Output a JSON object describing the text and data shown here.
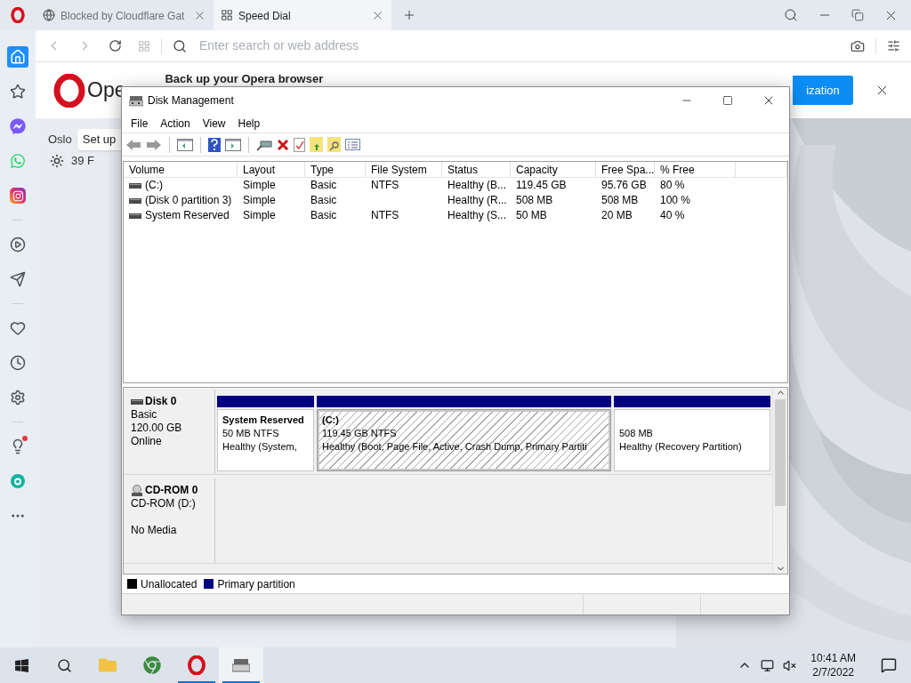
{
  "browser": {
    "tabs": [
      {
        "title": "Blocked by Cloudflare Gat",
        "selected": false
      },
      {
        "title": "Speed Dial",
        "selected": true
      }
    ],
    "address_placeholder": "Enter search or web address",
    "sidebar": [
      {
        "selected": true,
        "notification": false
      },
      {
        "selected": false,
        "notification": false
      },
      {
        "selected": false,
        "notification": false
      },
      {
        "selected": false,
        "notification": false
      },
      {
        "selected": false,
        "notification": false
      },
      {
        "selected": false,
        "notification": false
      },
      {
        "selected": false,
        "notification": false
      },
      {
        "selected": false,
        "notification": false
      },
      {
        "selected": false,
        "notification": false
      },
      {
        "selected": false,
        "notification": false
      },
      {
        "selected": false,
        "notification": true
      },
      {
        "selected": false,
        "notification": false
      },
      {
        "selected": false,
        "notification": false
      }
    ],
    "banner": {
      "logo_text": "Ope",
      "title": "Back up your Opera browser",
      "button": "ization"
    },
    "weather": {
      "city": "Oslo",
      "tooltip": "Set up",
      "temperature": "39 F"
    }
  },
  "disk_management": {
    "title": "Disk Management",
    "menu": [
      "File",
      "Action",
      "View",
      "Help"
    ],
    "columns": [
      "Volume",
      "Layout",
      "Type",
      "File System",
      "Status",
      "Capacity",
      "Free Spa...",
      "% Free"
    ],
    "rows": [
      [
        "(C:)",
        "Simple",
        "Basic",
        "NTFS",
        "Healthy (B...",
        "119.45 GB",
        "95.76 GB",
        "80 %"
      ],
      [
        "(Disk 0 partition 3)",
        "Simple",
        "Basic",
        "",
        "Healthy (R...",
        "508 MB",
        "508 MB",
        "100 %"
      ],
      [
        "System Reserved",
        "Simple",
        "Basic",
        "NTFS",
        "Healthy (S...",
        "50 MB",
        "20 MB",
        "40 %"
      ]
    ],
    "disks": [
      {
        "kind": "disk",
        "name": "Disk 0",
        "type": "Basic",
        "size": "120.00 GB",
        "status": "Online",
        "partitions": [
          {
            "name": "System Reserved",
            "size": "50 MB NTFS",
            "status": "Healthy (System,",
            "selected": false
          },
          {
            "name": "(C:)",
            "size": "119.45 GB NTFS",
            "status": "Healthy (Boot, Page File, Active, Crash Dump, Primary Partiti",
            "selected": true
          },
          {
            "size": "508 MB",
            "status": "Healthy (Recovery Partition)",
            "selected": false
          }
        ]
      },
      {
        "kind": "cdrom",
        "name": "CD-ROM 0",
        "type": "CD-ROM (D:)",
        "status": "No Media"
      }
    ],
    "legend": [
      {
        "label": "Unallocated",
        "color": "#000000"
      },
      {
        "label": "Primary partition",
        "color": "#000080"
      }
    ]
  },
  "taskbar": {
    "apps": [
      {
        "running": false,
        "selected": false
      },
      {
        "running": false,
        "selected": false
      },
      {
        "running": true,
        "selected": false
      },
      {
        "running": true,
        "selected": true
      }
    ],
    "time": "10:41 AM",
    "date": "2/7/2022"
  }
}
